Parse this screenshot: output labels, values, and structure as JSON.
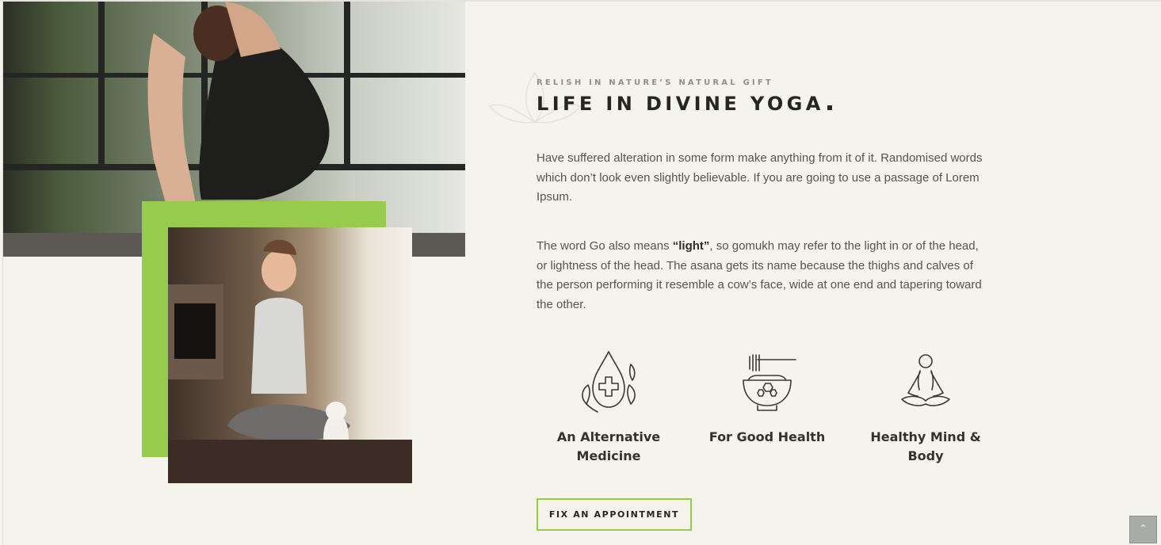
{
  "section": {
    "eyebrow": "RELISH IN NATURE’S NATURAL GIFT",
    "title": "LIFE IN DIVINE YOGA",
    "paragraph_1": "Have suffered alteration in some form make anything from it of it. Randomised words which don’t look even slightly believable. If you are going to use a passage of Lorem Ipsum.",
    "paragraph_2_prefix": "The word Go also means ",
    "paragraph_2_bold": "“light”",
    "paragraph_2_suffix": ", so gomukh may refer to the light in or of the head, or lightness of the head. The asana gets its name because the thighs and calves of the person performing it resemble a cow’s face, wide at one end and tapering toward the other."
  },
  "features": [
    {
      "icon": "medicine-drop-icon",
      "label": "An Alternative Medicine"
    },
    {
      "icon": "health-bowl-icon",
      "label": "For Good Health"
    },
    {
      "icon": "meditation-icon",
      "label": "Healthy Mind & Body"
    }
  ],
  "cta": {
    "label": "FIX AN APPOINTMENT"
  },
  "scroll_top": {
    "glyph": "⌃"
  },
  "colors": {
    "accent": "#97cb4c",
    "background": "#f5f4ec",
    "heading": "#262621",
    "text": "#55554e"
  }
}
